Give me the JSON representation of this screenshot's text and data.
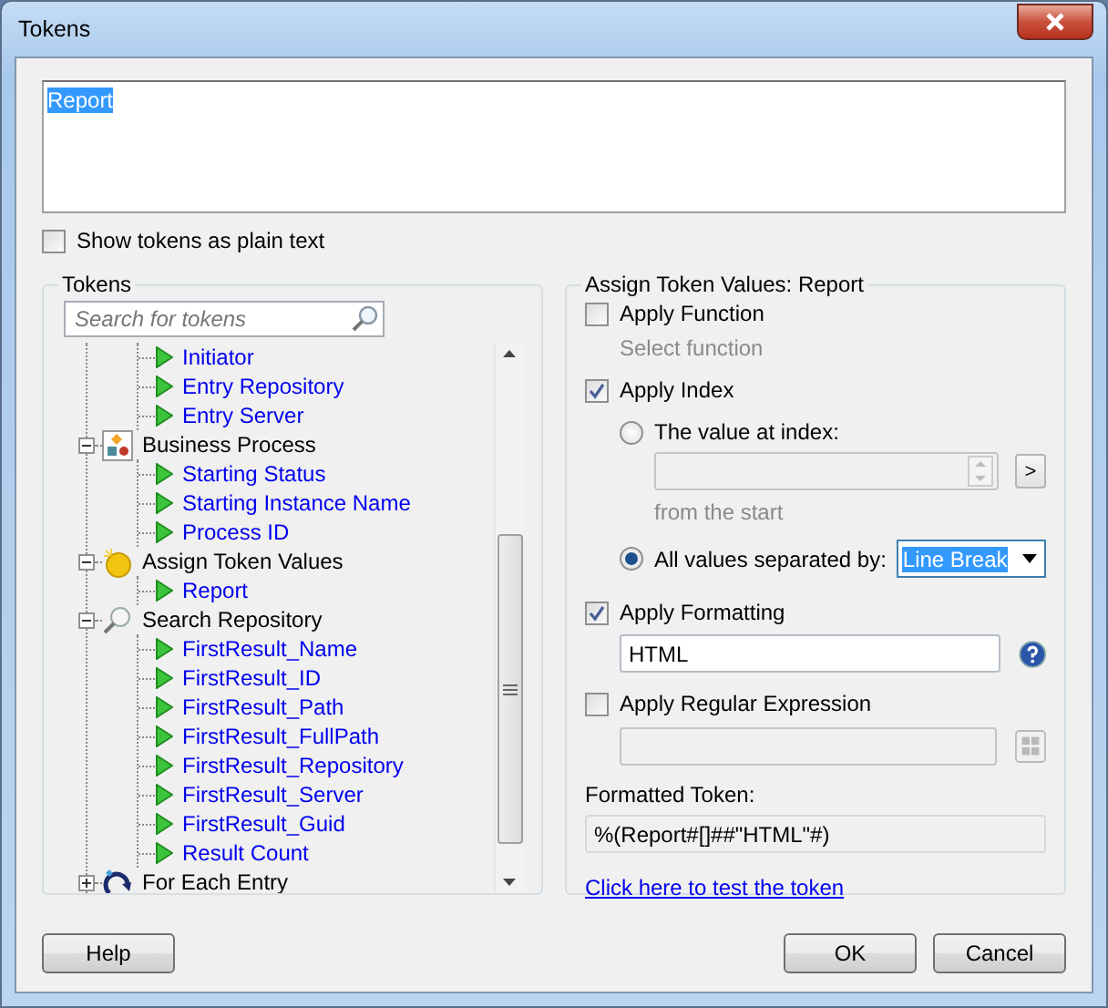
{
  "window": {
    "title": "Tokens"
  },
  "token_text": {
    "value": "Report",
    "selected": true
  },
  "show_plain": {
    "label": "Show tokens as plain text",
    "checked": false
  },
  "tokens_panel": {
    "title": "Tokens",
    "search": {
      "placeholder": "Search for tokens"
    },
    "tree": [
      {
        "children": [
          {
            "label": "Initiator"
          },
          {
            "label": "Entry Repository"
          },
          {
            "label": "Entry Server"
          }
        ]
      },
      {
        "label": "Business Process",
        "kind": "process",
        "expanded": true,
        "children": [
          {
            "label": "Starting Status"
          },
          {
            "label": "Starting Instance Name"
          },
          {
            "label": "Process ID"
          }
        ]
      },
      {
        "label": "Assign Token Values",
        "kind": "coin",
        "expanded": true,
        "children": [
          {
            "label": "Report"
          }
        ]
      },
      {
        "label": "Search Repository",
        "kind": "search",
        "expanded": true,
        "children": [
          {
            "label": "FirstResult_Name"
          },
          {
            "label": "FirstResult_ID"
          },
          {
            "label": "FirstResult_Path"
          },
          {
            "label": "FirstResult_FullPath"
          },
          {
            "label": "FirstResult_Repository"
          },
          {
            "label": "FirstResult_Server"
          },
          {
            "label": "FirstResult_Guid"
          },
          {
            "label": "Result Count"
          }
        ]
      },
      {
        "label": "For Each Entry",
        "kind": "loop",
        "expanded": false
      }
    ]
  },
  "assign_panel": {
    "title": "Assign Token Values: Report",
    "apply_function": {
      "label": "Apply Function",
      "checked": false,
      "hint": "Select function"
    },
    "apply_index": {
      "label": "Apply Index",
      "checked": true,
      "options": [
        {
          "label": "The value at index:",
          "selected": false
        },
        {
          "label": "All values separated by:",
          "selected": true
        }
      ],
      "go_button": ">",
      "index_note": "from the  start",
      "separator": "Line Break"
    },
    "apply_formatting": {
      "label": "Apply Formatting",
      "checked": true,
      "value": "HTML"
    },
    "apply_regex": {
      "label": "Apply Regular Expression",
      "checked": false
    },
    "formatted_token": {
      "label": "Formatted Token:",
      "value": "%(Report#[]##\"HTML\"#)"
    },
    "test_link": "Click here to test the token"
  },
  "buttons": {
    "help": "Help",
    "ok": "OK",
    "cancel": "Cancel"
  }
}
